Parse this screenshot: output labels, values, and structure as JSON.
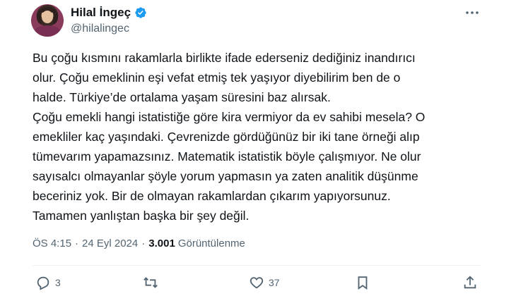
{
  "author": {
    "name": "Hilal İngeç",
    "handle": "@hilalingec",
    "verified": true,
    "verified_color": "#1d9bf0"
  },
  "tweet": {
    "lines": [
      "Bu çoğu kısmını rakamlarla birlikte ifade ederseniz dediğiniz inandırıcı",
      "olur. Çoğu emeklinin eşi vefat etmiş tek yaşıyor diyebilirim ben de o",
      "halde. Türkiye’de ortalama yaşam süresini baz alırsak.",
      "Çoğu emekli hangi istatistiğe göre kira vermiyor da ev sahibi mesela? O",
      "emekliler kaç yaşındaki. Çevrenizde gördüğünüz bir iki tane örneği alıp",
      "tümevarım yapamazsınız. Matematik istatistik böyle çalışmıyor. Ne olur",
      "sayısalcı olmayanlar şöyle yorum yapmasın ya zaten analitik düşünme",
      "beceriniz yok. Bir de olmayan rakamlardan çıkarım yapıyorsunuz.",
      "Tamamen yanlıştan başka bir şey değil."
    ]
  },
  "meta": {
    "time": "ÖS 4:15",
    "date": "24 Eyl 2024",
    "separator": "·",
    "views_count": "3.001",
    "views_label": "Görüntülenme"
  },
  "actions": {
    "reply_count": "3",
    "retweet_count": "",
    "like_count": "37",
    "bookmark_icon": "bookmark-icon",
    "share_icon": "share-icon"
  }
}
